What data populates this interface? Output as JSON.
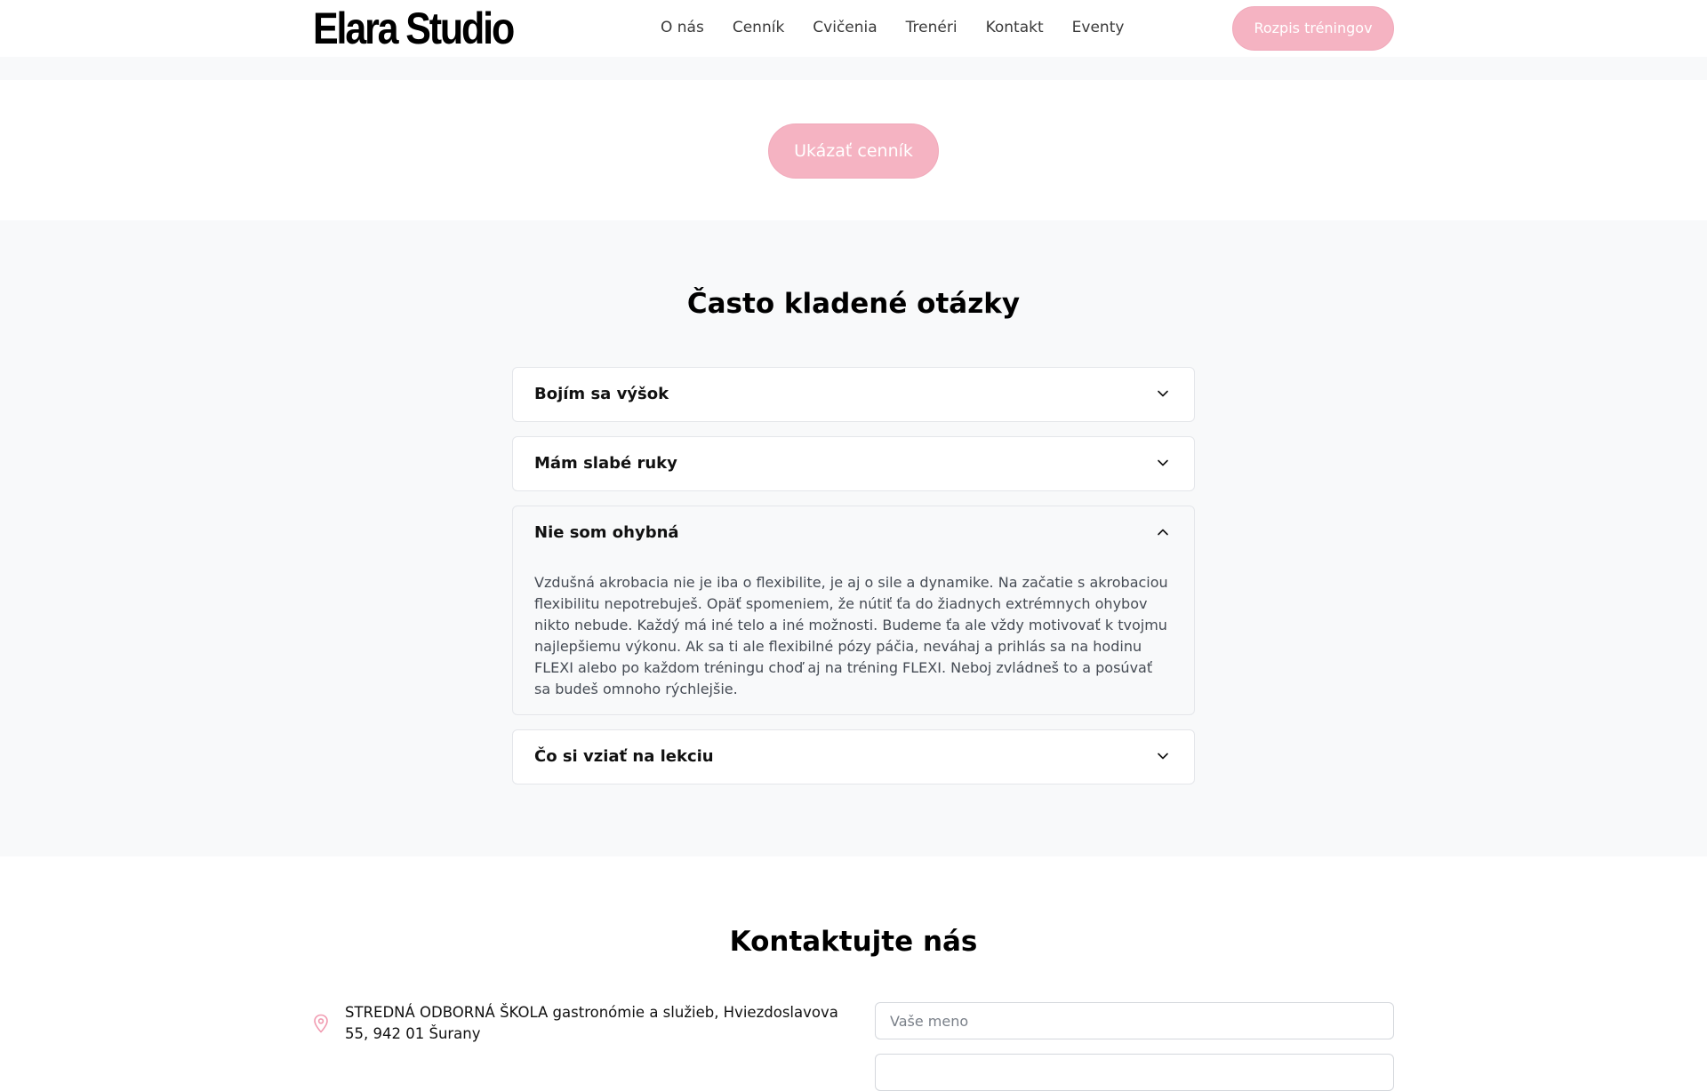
{
  "header": {
    "logo": "Elara Studio",
    "nav": [
      "O nás",
      "Cenník",
      "Cvičenia",
      "Trenéri",
      "Kontakt",
      "Eventy"
    ],
    "schedule_button": "Rozpis tréningov"
  },
  "pricing": {
    "show_button": "Ukázať cenník"
  },
  "faq": {
    "title": "Často kladené otázky",
    "items": [
      {
        "question": "Bojím sa výšok",
        "open": false
      },
      {
        "question": "Mám slabé ruky",
        "open": false
      },
      {
        "question": "Nie som ohybná",
        "open": true,
        "answer": "Vzdušná akrobacia nie je iba o flexibilite, je aj o sile a dynamike. Na začatie s akrobaciou flexibilitu nepotrebuješ. Opäť spomeniem, že nútiť ťa do žiadnych extrémnych ohybov nikto nebude. Každý má iné telo a iné možnosti. Budeme ťa ale vždy motivovať k tvojmu najlepšiemu výkonu. Ak sa ti ale flexibilné pózy páčia, neváhaj a prihlás sa na hodinu FLEXI alebo po každom tréningu choď aj na tréning FLEXI. Neboj zvládneš to a posúvať sa budeš omnoho rýchlejšie."
      },
      {
        "question": "Čo si vziať na lekciu",
        "open": false
      }
    ]
  },
  "contact": {
    "title": "Kontaktujte nás",
    "address": "STREDNÁ ODBORNÁ ŠKOLA gastronómie a služieb, Hviezdoslavova 55, 942 01 Šurany",
    "name_placeholder": "Vaše meno"
  },
  "colors": {
    "accent": "#f5b3c2",
    "section_bg": "#f8f9fa"
  },
  "icons": {
    "faq_closed": "chevron-down-icon",
    "faq_open": "chevron-up-icon",
    "address": "map-pin-icon"
  }
}
